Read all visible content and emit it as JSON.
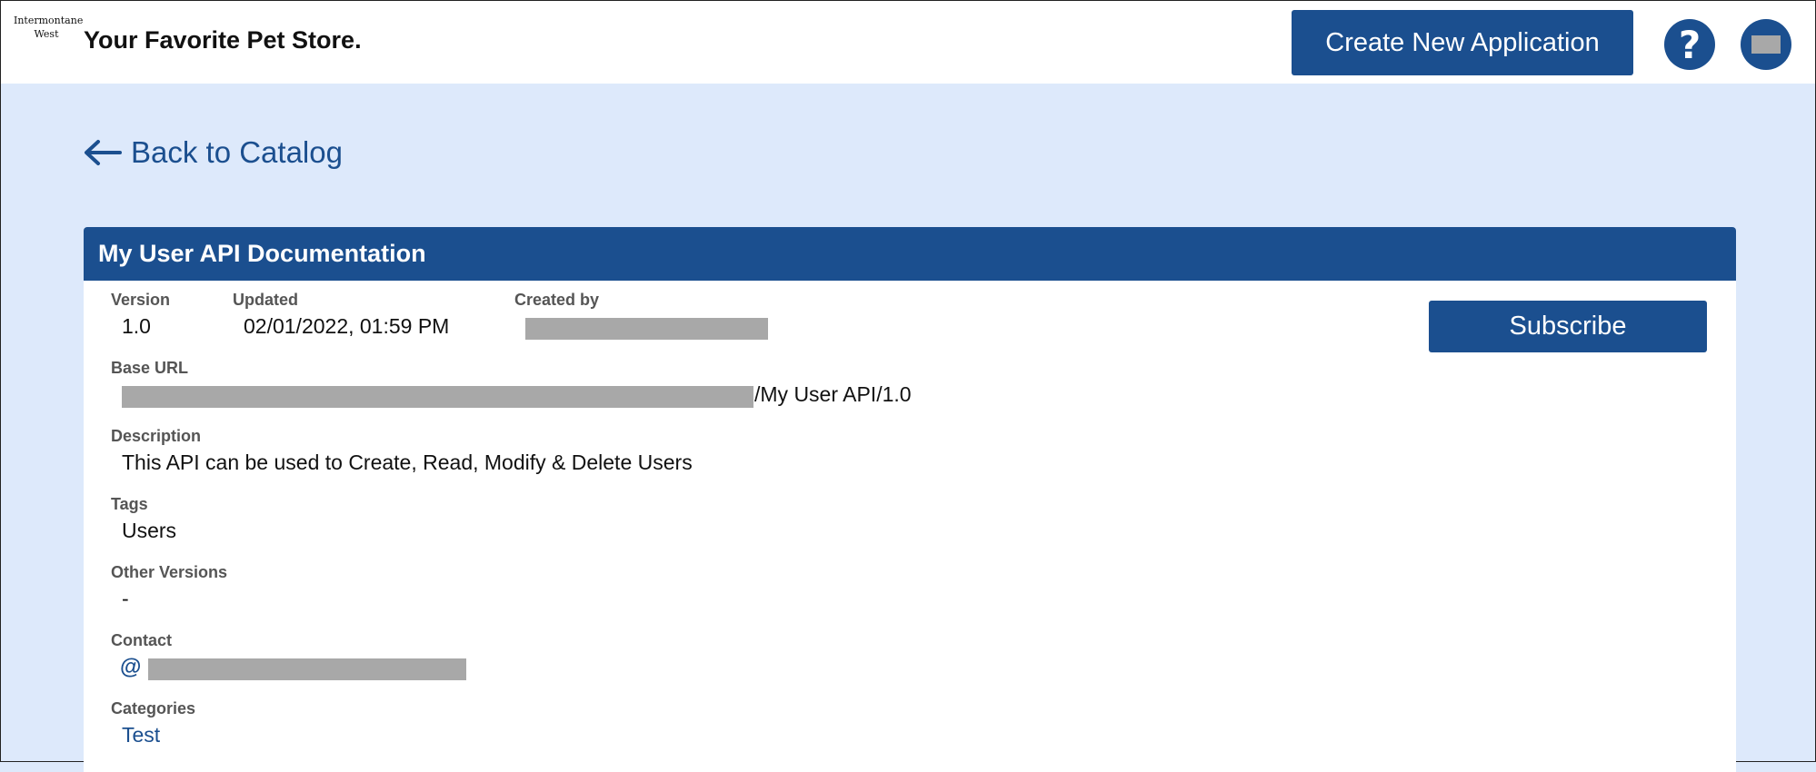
{
  "header": {
    "logo_line1": "Intermontane",
    "logo_line2": "West",
    "store_title": "Your Favorite Pet Store.",
    "create_app_label": "Create New Application",
    "help_label": "?"
  },
  "nav": {
    "back_label": "Back to Catalog"
  },
  "api": {
    "title": "My User API Documentation",
    "version_label": "Version",
    "version": "1.0",
    "updated_label": "Updated",
    "updated": "02/01/2022, 01:59 PM",
    "created_by_label": "Created by",
    "subscribe_label": "Subscribe",
    "base_url_label": "Base URL",
    "base_url_suffix": "/My User API/1.0",
    "description_label": "Description",
    "description": "This API can be used to Create, Read, Modify & Delete Users",
    "tags_label": "Tags",
    "tags": "Users",
    "other_versions_label": "Other Versions",
    "other_versions": "-",
    "contact_label": "Contact",
    "contact_icon": "@",
    "categories_label": "Categories",
    "categories": [
      "Test"
    ]
  },
  "colors": {
    "brand": "#1b4f8f",
    "page_bg": "#dde9fb",
    "redaction": "#a8a8a8"
  }
}
